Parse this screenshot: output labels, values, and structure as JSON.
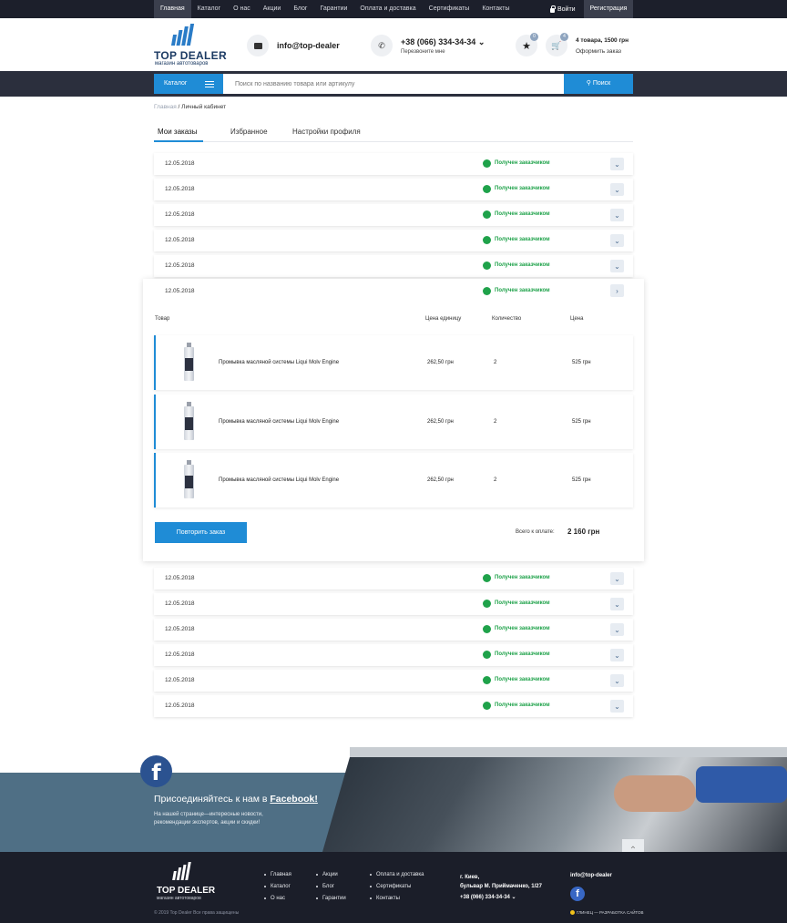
{
  "topnav": {
    "items": [
      "Главная",
      "Каталог",
      "О нас",
      "Акции",
      "Блог",
      "Гарантии",
      "Оплата и доставка",
      "Сертификаты",
      "Контакты"
    ],
    "login": "Войти",
    "register": "Регистрация"
  },
  "header": {
    "logo_name": "TOP DEALER",
    "logo_sub": "магазин автотоваров",
    "email": "info@top-dealer",
    "phone": "+38 (066) 334-34-34",
    "callback": "Перезвоните мне",
    "fav_count": "0",
    "cart_count": "4",
    "cart_summary": "4 товара, 1500 грн",
    "checkout": "Оформить заказ"
  },
  "search": {
    "catalog_label": "Каталог",
    "placeholder": "Поиск по названию товара или артикулу",
    "button_label": "Поиск"
  },
  "breadcrumb": {
    "home": "Главная",
    "separator": " / ",
    "current": "Личный кабинет"
  },
  "tabs": [
    "Мои заказы",
    "Избранное",
    "Настройки профиля"
  ],
  "orders_top": [
    {
      "date": "12.05.2018",
      "status": "Получен заказчиком"
    },
    {
      "date": "12.05.2018",
      "status": "Получен заказчиком"
    },
    {
      "date": "12.05.2018",
      "status": "Получен заказчиком"
    },
    {
      "date": "12.05.2018",
      "status": "Получен заказчиком"
    },
    {
      "date": "12.05.2018",
      "status": "Получен заказчиком"
    }
  ],
  "expanded": {
    "date": "12.05.2018",
    "status": "Получен заказчиком",
    "headers": {
      "product": "Товар",
      "unit_price": "Цена единицу",
      "qty": "Количество",
      "price": "Цена"
    },
    "items": [
      {
        "name": "Промывка  масляной системы Liqui Molv Engine",
        "unit_price": "262,50 грн",
        "qty": "2",
        "price": "525 грн"
      },
      {
        "name": "Промывка  масляной системы Liqui Molv Engine",
        "unit_price": "262,50 грн",
        "qty": "2",
        "price": "525 грн"
      },
      {
        "name": "Промывка  масляной системы Liqui Molv Engine",
        "unit_price": "262,50 грн",
        "qty": "2",
        "price": "525 грн"
      }
    ],
    "repeat_label": "Повторить заказ",
    "total_label": "Всего к оплате:",
    "total_value": "2 160 грн"
  },
  "orders_bottom": [
    {
      "date": "12.05.2018",
      "status": "Получен заказчиком"
    },
    {
      "date": "12.05.2018",
      "status": "Получен заказчиком"
    },
    {
      "date": "12.05.2018",
      "status": "Получен заказчиком"
    },
    {
      "date": "12.05.2018",
      "status": "Получен заказчиком"
    },
    {
      "date": "12.05.2018",
      "status": "Получен заказчиком"
    },
    {
      "date": "12.05.2018",
      "status": "Получен заказчиком"
    }
  ],
  "facebook": {
    "title_prefix": "Присоединяйтесь к нам в ",
    "title_link": "Facebook!",
    "text": "На нашей странице—интересные новости, рекомендации экспертов, акции и скидки!"
  },
  "footer": {
    "logo_name": "TOP DEALER",
    "logo_sub": "магазин автотоваров",
    "col1": [
      "Главная",
      "Каталог",
      "О нас"
    ],
    "col2": [
      "Акции",
      "Блог",
      "Гарантии"
    ],
    "col3": [
      "Оплата и доставка",
      "Сертификаты",
      "Контакты"
    ],
    "city": "г. Киев,",
    "street": "бульвар М. Приймаченко, 1/27",
    "phone": "+38 (066) 334-34-34",
    "email": "info@top-dealer",
    "copyright": "© 2019 Top Dealer Все права защищены",
    "developer": "ГЛИНЕЦ — РАЗРАБОТКА САЙТОВ"
  },
  "colors": {
    "accent": "#1f8cd6",
    "status_green": "#1fa24a",
    "dark": "#1b1e29"
  }
}
